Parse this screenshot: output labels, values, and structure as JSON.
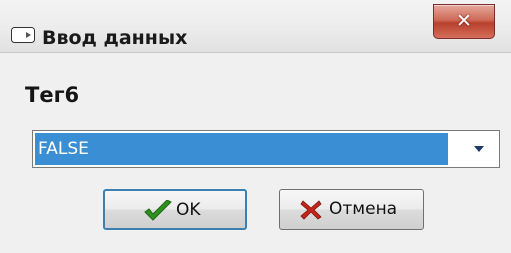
{
  "window": {
    "title": "Ввод данных",
    "close_icon": "close-icon"
  },
  "form": {
    "label": "Тег6",
    "combo_value": "FALSE"
  },
  "buttons": {
    "ok_label": "OK",
    "cancel_label": "Отмена"
  },
  "colors": {
    "selection": "#3a8fd4",
    "close_button": "#c94c3a",
    "ok_check": "#2f8f1f",
    "cancel_x": "#c2261b"
  }
}
